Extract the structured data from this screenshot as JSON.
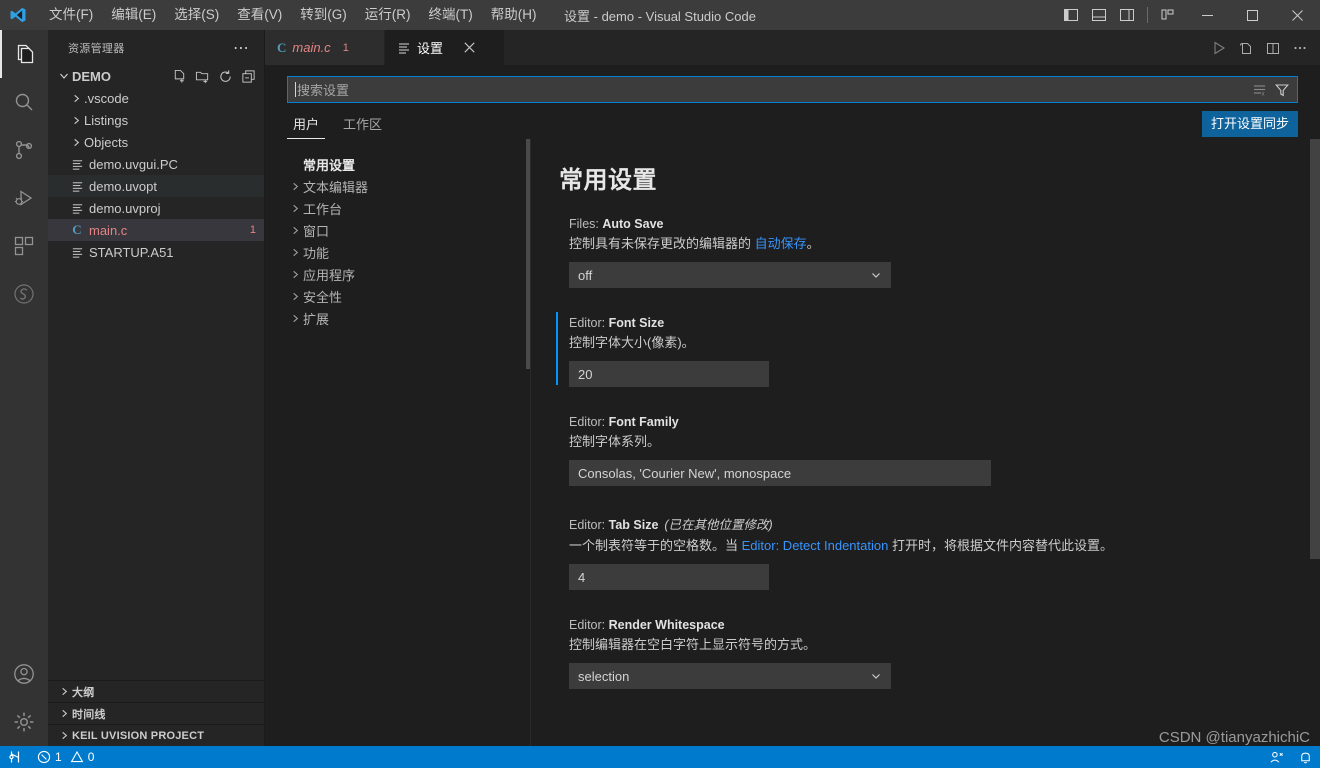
{
  "titlebar": {
    "logo_icon": "vscode-logo",
    "window_title": "设置 - demo - Visual Studio Code",
    "menus": [
      {
        "label": "文件(F)"
      },
      {
        "label": "编辑(E)"
      },
      {
        "label": "选择(S)"
      },
      {
        "label": "查看(V)"
      },
      {
        "label": "转到(G)"
      },
      {
        "label": "运行(R)"
      },
      {
        "label": "终端(T)"
      },
      {
        "label": "帮助(H)"
      }
    ],
    "layout_buttons": [
      {
        "name": "toggle-primary-sidebar-icon"
      },
      {
        "name": "toggle-panel-icon"
      },
      {
        "name": "toggle-secondary-sidebar-icon"
      },
      {
        "name": "customize-layout-icon"
      }
    ],
    "window_controls": [
      {
        "name": "minimize-icon",
        "glyph": "—"
      },
      {
        "name": "maximize-icon",
        "glyph": "☐"
      },
      {
        "name": "close-icon",
        "glyph": "✕"
      }
    ]
  },
  "activitybar": {
    "items": [
      {
        "name": "explorer",
        "icon": "files-icon",
        "active": true
      },
      {
        "name": "search",
        "icon": "search-icon",
        "active": false
      },
      {
        "name": "source-control",
        "icon": "source-control-icon",
        "active": false
      },
      {
        "name": "run-debug",
        "icon": "run-and-debug-icon",
        "active": false
      },
      {
        "name": "extensions",
        "icon": "extensions-icon",
        "active": false
      },
      {
        "name": "keil-assistant",
        "icon": "keil-s-icon",
        "active": false
      }
    ],
    "bottom_items": [
      {
        "name": "accounts",
        "icon": "account-icon"
      },
      {
        "name": "manage",
        "icon": "gear-icon"
      }
    ]
  },
  "sidebar": {
    "title": "资源管理器",
    "more_actions_icon": "ellipsis-icon",
    "folder": {
      "label": "DEMO",
      "actions": [
        {
          "name": "new-file-icon"
        },
        {
          "name": "new-folder-icon"
        },
        {
          "name": "refresh-icon"
        },
        {
          "name": "collapse-all-icon"
        }
      ]
    },
    "tree": [
      {
        "label": ".vscode",
        "type": "folder",
        "state": "collapsed"
      },
      {
        "label": "Listings",
        "type": "folder",
        "state": "collapsed"
      },
      {
        "label": "Objects",
        "type": "folder",
        "state": "collapsed"
      },
      {
        "label": "demo.uvgui.PC",
        "type": "file",
        "icon": "text-file-icon",
        "state": "normal"
      },
      {
        "label": "demo.uvopt",
        "type": "file",
        "icon": "text-file-icon",
        "state": "hovered"
      },
      {
        "label": "demo.uvproj",
        "type": "file",
        "icon": "text-file-icon",
        "state": "normal"
      },
      {
        "label": "main.c",
        "type": "file",
        "icon": "c-file-icon",
        "state": "selected",
        "badge": "1"
      },
      {
        "label": "STARTUP.A51",
        "type": "file",
        "icon": "text-file-icon",
        "state": "normal"
      }
    ],
    "panels": [
      {
        "label": "大纲"
      },
      {
        "label": "时间线"
      },
      {
        "label": "KEIL UVISION PROJECT"
      }
    ]
  },
  "editor": {
    "tabs": [
      {
        "label": "main.c",
        "icon": "c-file-icon",
        "badge": "1",
        "active": false,
        "dirty": true,
        "closable": false
      },
      {
        "label": "设置",
        "icon": "settings-file-icon",
        "badge": "",
        "active": true,
        "dirty": false,
        "closable": true
      }
    ],
    "actions": [
      {
        "name": "run-code-icon"
      },
      {
        "name": "split-editor-file-icon"
      },
      {
        "name": "split-editor-right-icon"
      },
      {
        "name": "more-actions-icon"
      }
    ]
  },
  "settings": {
    "search": {
      "placeholder": "搜索设置",
      "value": "",
      "clear_filters_icon": "clear-filters-icon",
      "filter_icon": "filter-funnel-icon"
    },
    "scope_tabs": [
      {
        "label": "用户",
        "active": true
      },
      {
        "label": "工作区",
        "active": false
      }
    ],
    "sync_button": "打开设置同步",
    "toc": [
      {
        "label": "常用设置",
        "root": true,
        "expandable": false
      },
      {
        "label": "文本编辑器",
        "root": false,
        "expandable": true
      },
      {
        "label": "工作台",
        "root": false,
        "expandable": true
      },
      {
        "label": "窗口",
        "root": false,
        "expandable": true
      },
      {
        "label": "功能",
        "root": false,
        "expandable": true
      },
      {
        "label": "应用程序",
        "root": false,
        "expandable": true
      },
      {
        "label": "安全性",
        "root": false,
        "expandable": true
      },
      {
        "label": "扩展",
        "root": false,
        "expandable": true
      }
    ],
    "section_title": "常用设置",
    "items": [
      {
        "key_prefix": "Files: ",
        "key_name": "Auto Save",
        "modified_elsewhere": "",
        "desc_parts": [
          {
            "text": "控制具有未保存更改的编辑器的 ",
            "link": false
          },
          {
            "text": "自动保存",
            "link": true
          },
          {
            "text": "。",
            "link": false
          }
        ],
        "control": "select",
        "value": "off",
        "modified": false,
        "width": "select"
      },
      {
        "key_prefix": "Editor: ",
        "key_name": "Font Size",
        "modified_elsewhere": "",
        "desc_parts": [
          {
            "text": "控制字体大小(像素)。",
            "link": false
          }
        ],
        "control": "input",
        "value": "20",
        "modified": true,
        "width": "small"
      },
      {
        "key_prefix": "Editor: ",
        "key_name": "Font Family",
        "modified_elsewhere": "",
        "desc_parts": [
          {
            "text": "控制字体系列。",
            "link": false
          }
        ],
        "control": "input",
        "value": "Consolas, 'Courier New', monospace",
        "modified": false,
        "width": "large"
      },
      {
        "key_prefix": "Editor: ",
        "key_name": "Tab Size",
        "modified_elsewhere": "(已在其他位置修改)",
        "desc_parts": [
          {
            "text": "一个制表符等于的空格数。当 ",
            "link": false
          },
          {
            "text": "Editor: Detect Indentation",
            "link": true
          },
          {
            "text": " 打开时，将根据文件内容替代此设置。",
            "link": false
          }
        ],
        "control": "input",
        "value": "4",
        "modified": false,
        "width": "small"
      },
      {
        "key_prefix": "Editor: ",
        "key_name": "Render Whitespace",
        "modified_elsewhere": "",
        "desc_parts": [
          {
            "text": "控制编辑器在空白字符上显示符号的方式。",
            "link": false
          }
        ],
        "control": "select",
        "value": "selection",
        "modified": false,
        "width": "select"
      }
    ]
  },
  "statusbar": {
    "remote_icon": "remote-window-icon",
    "problems": {
      "error_icon": "error-circle-icon",
      "errors": "1",
      "warning_icon": "warning-triangle-icon",
      "warnings": "0"
    },
    "right_items": [
      {
        "name": "feedback-icon"
      },
      {
        "name": "bell-icon"
      }
    ]
  },
  "watermark": "CSDN @tianyazhichiC",
  "colors": {
    "accent": "#007acc",
    "title_bg": "#3c3c3c",
    "sidebar_bg": "#252526",
    "editor_bg": "#1e1e1e",
    "link": "#3794ff",
    "modified_indicator": "#0097fb",
    "button_bg": "#0e639c"
  }
}
